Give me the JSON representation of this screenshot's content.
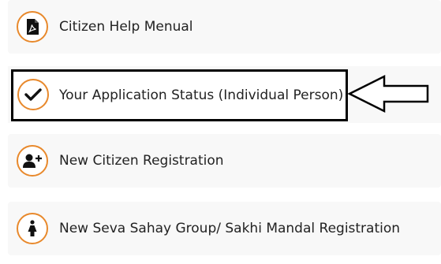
{
  "menu": {
    "items": [
      {
        "label": "Citizen Help Menual",
        "icon": "pdf-file-icon"
      },
      {
        "label": "Your Application Status (Individual Person)",
        "icon": "checkmark-icon"
      },
      {
        "label": "New Citizen Registration",
        "icon": "add-user-icon"
      },
      {
        "label": "New Seva Sahay Group/ Sakhi Mandal Registration",
        "icon": "woman-icon"
      }
    ]
  },
  "colors": {
    "icon_ring": "#e8892c",
    "highlight_border": "#000000",
    "card_background": "#f8f8f8"
  }
}
